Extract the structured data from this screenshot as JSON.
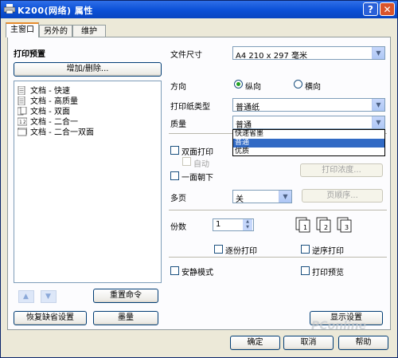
{
  "window": {
    "title": "K200(网络) 属性"
  },
  "title_buttons": {
    "help": "?",
    "close": "✕"
  },
  "tabs": [
    {
      "label": "主窗口",
      "active": true
    },
    {
      "label": "另外的"
    },
    {
      "label": "维护"
    }
  ],
  "left": {
    "heading": "打印预置",
    "add_remove_label": "增加/删除...",
    "presets": [
      "文档 - 快速",
      "文档 - 高质量",
      "文档 - 双面",
      "文档 - 二合一",
      "文档 - 二合一双面"
    ],
    "up_arrow": "▲",
    "down_arrow": "▼",
    "reset_command_label": "重置命令",
    "restore_defaults_label": "恢复缺省设置",
    "ink_label": "墨量"
  },
  "right": {
    "paper_size": {
      "label": "文件尺寸",
      "value": "A4 210 x 297 毫米"
    },
    "orientation": {
      "label": "方向",
      "options": [
        "纵向",
        "横向"
      ],
      "selected": "纵向"
    },
    "paper_type": {
      "label": "打印纸类型",
      "value": "普通纸"
    },
    "quality": {
      "label": "质量",
      "value": "普通",
      "options": [
        "快速省墨",
        "普通",
        "优质"
      ],
      "highlighted": "普通"
    },
    "duplex": {
      "label": "双面打印",
      "auto_label": "自动",
      "density_label": "打印浓度..."
    },
    "face_down_label": "一面朝下",
    "multipage": {
      "label": "多页",
      "value": "关",
      "order_label": "页顺序..."
    },
    "copies": {
      "label": "份数",
      "value": "1"
    },
    "collate_label": "逐份打印",
    "reverse_label": "逆序打印",
    "quiet_label": "安静模式",
    "preview_label": "打印预览",
    "show_settings_label": "显示设置"
  },
  "dropdown_arrow": "▼",
  "spin_up": "▲",
  "spin_down": "▼",
  "copy_icon_labels": [
    "1",
    "2",
    "3"
  ],
  "footer": {
    "ok": "确定",
    "cancel": "取消",
    "help": "帮助"
  },
  "watermark": "PConline"
}
